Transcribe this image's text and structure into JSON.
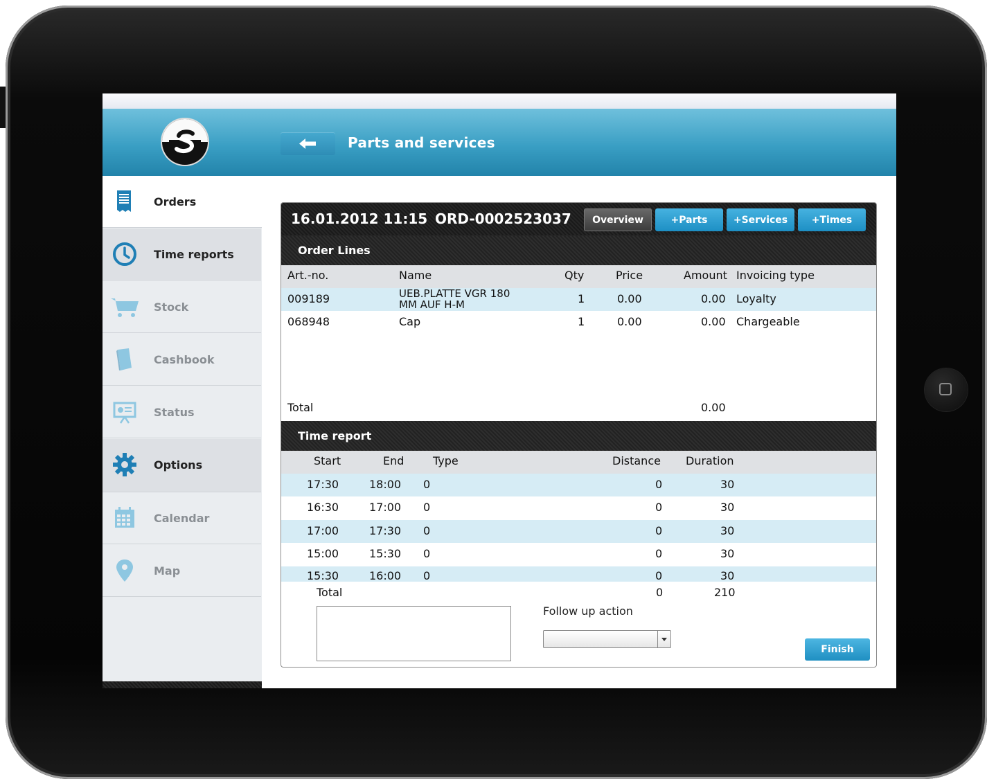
{
  "header": {
    "title": "Parts and services",
    "back_icon": "arrow-left-icon"
  },
  "sidebar": {
    "items": [
      {
        "label": "Orders",
        "icon": "orders-icon"
      },
      {
        "label": "Time reports",
        "icon": "clock-icon"
      },
      {
        "label": "Stock",
        "icon": "cart-icon"
      },
      {
        "label": "Cashbook",
        "icon": "book-icon"
      },
      {
        "label": "Status",
        "icon": "presentation-icon"
      },
      {
        "label": "Options",
        "icon": "gear-icon"
      },
      {
        "label": "Calendar",
        "icon": "calendar-icon"
      },
      {
        "label": "Map",
        "icon": "map-pin-icon"
      }
    ]
  },
  "order": {
    "datetime": "16.01.2012 11:15",
    "number": "ORD-0002523037",
    "buttons": {
      "overview": "Overview",
      "parts": "+Parts",
      "services": "+Services",
      "times": "+Times"
    }
  },
  "order_lines": {
    "title": "Order Lines",
    "columns": {
      "art": "Art.-no.",
      "name": "Name",
      "qty": "Qty",
      "price": "Price",
      "amount": "Amount",
      "invoicing": "Invoicing type"
    },
    "rows": [
      {
        "art": "009189",
        "name_line1": "UEB.PLATTE VGR 180",
        "name_line2": "MM AUF H-M",
        "qty": "1",
        "price": "0.00",
        "amount": "0.00",
        "invoicing": "Loyalty"
      },
      {
        "art": "068948",
        "name_line1": "Cap",
        "name_line2": "",
        "qty": "1",
        "price": "0.00",
        "amount": "0.00",
        "invoicing": "Chargeable"
      }
    ],
    "total_label": "Total",
    "total_amount": "0.00"
  },
  "time_report": {
    "title": "Time report",
    "columns": {
      "start": "Start",
      "end": "End",
      "type": "Type",
      "distance": "Distance",
      "duration": "Duration"
    },
    "rows": [
      {
        "start": "17:30",
        "end": "18:00",
        "type": "0",
        "distance": "0",
        "duration": "30"
      },
      {
        "start": "16:30",
        "end": "17:00",
        "type": "0",
        "distance": "0",
        "duration": "30"
      },
      {
        "start": "17:00",
        "end": "17:30",
        "type": "0",
        "distance": "0",
        "duration": "30"
      },
      {
        "start": "15:00",
        "end": "15:30",
        "type": "0",
        "distance": "0",
        "duration": "30"
      },
      {
        "start": "15:30",
        "end": "16:00",
        "type": "0",
        "distance": "0",
        "duration": "30"
      }
    ],
    "total_label": "Total",
    "total_distance": "0",
    "total_duration": "210"
  },
  "footer": {
    "follow_up_label": "Follow up action",
    "follow_up_value": "",
    "finish_label": "Finish"
  },
  "colors": {
    "header_blue": "#3a9fc4",
    "button_blue": "#1d8fc4",
    "row_highlight": "#d6ecf5"
  }
}
